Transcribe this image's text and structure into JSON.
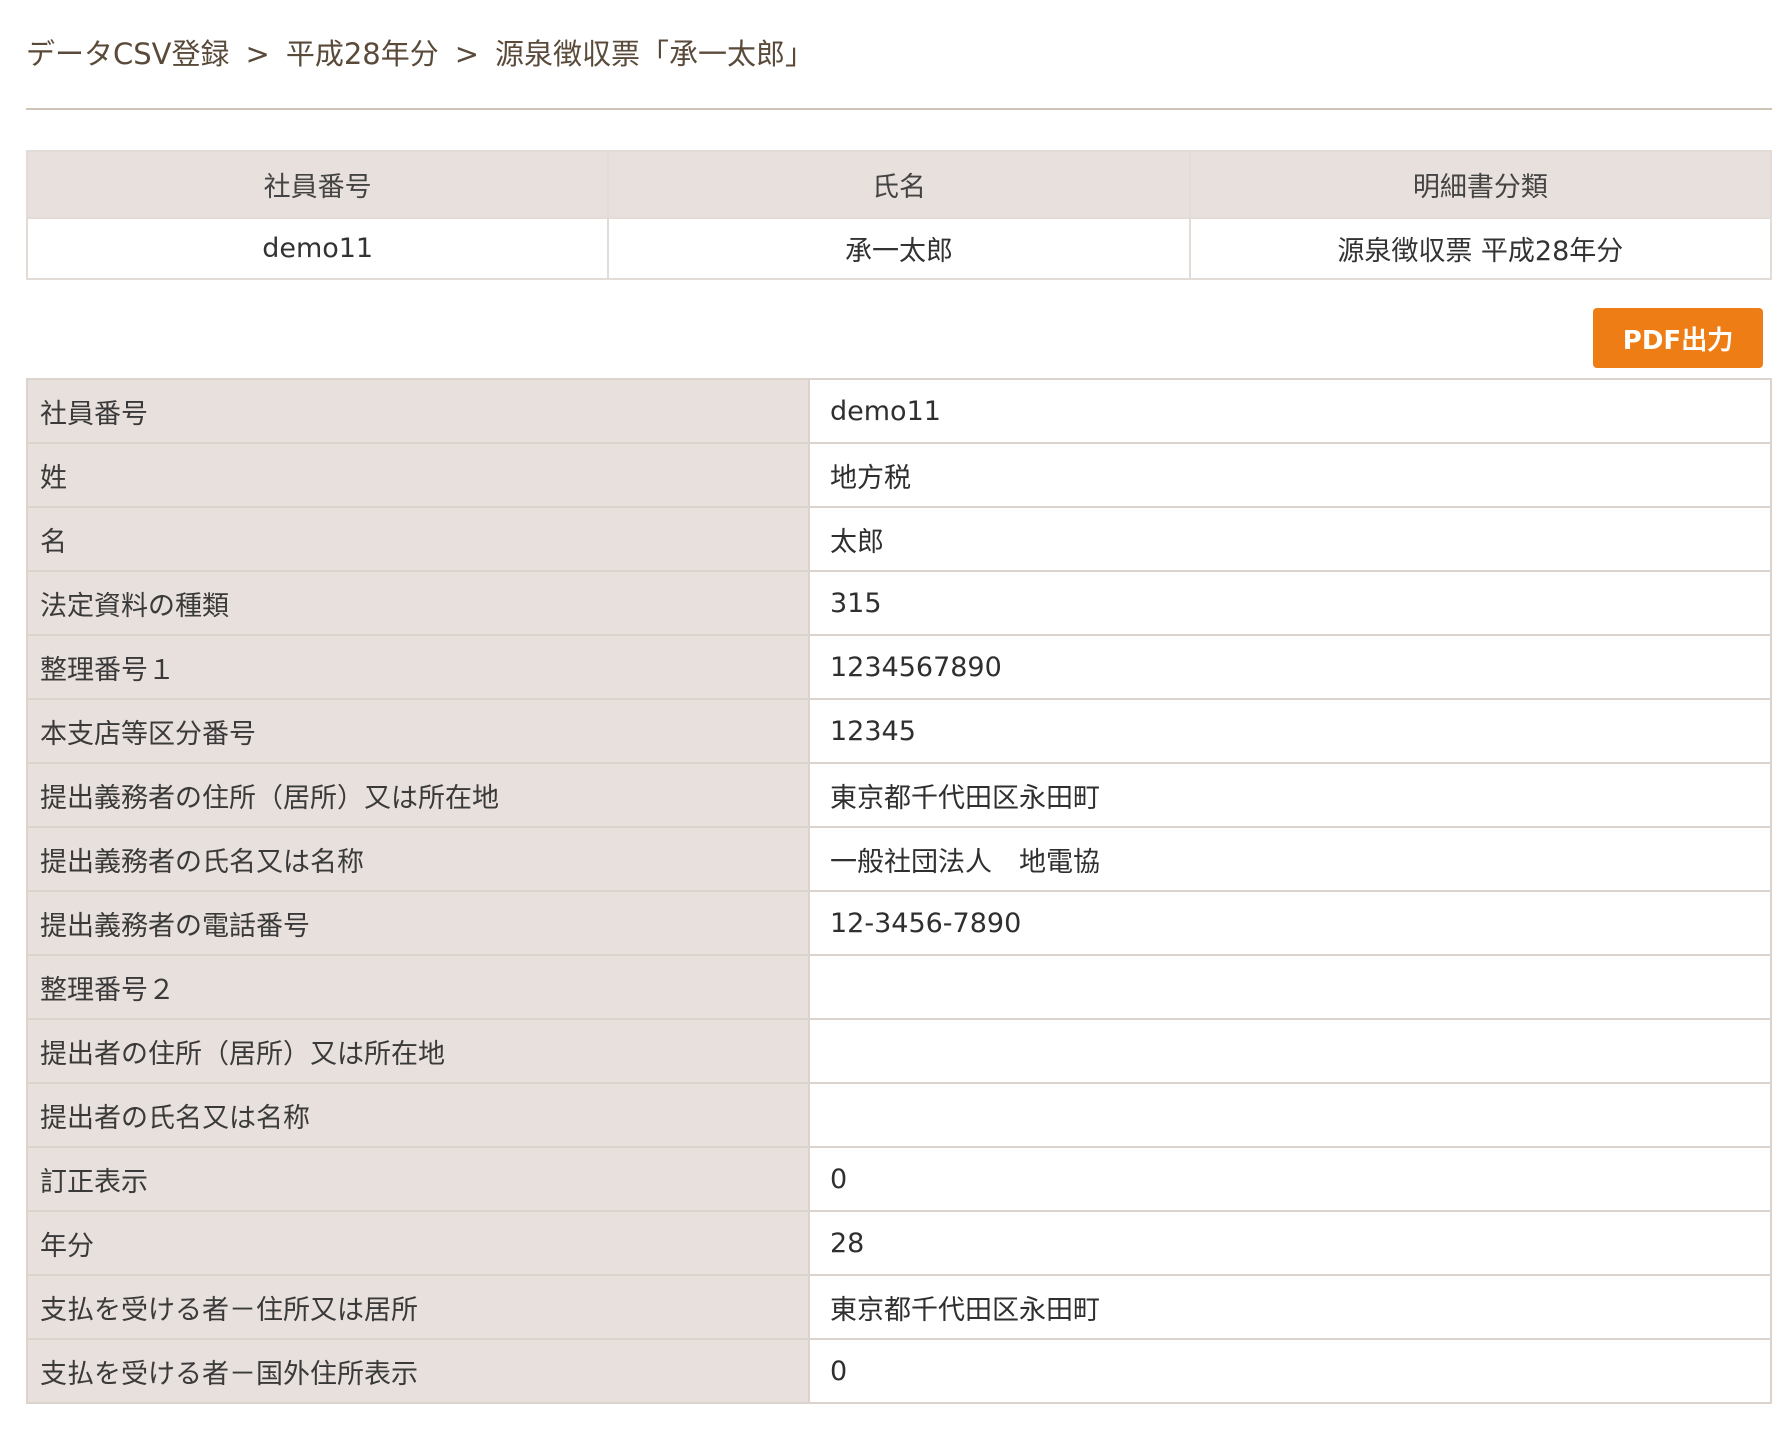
{
  "breadcrumb": {
    "level1": "データCSV登録",
    "level2": "平成28年分",
    "level3": "源泉徴収票「承一太郎」",
    "separator": ">"
  },
  "summary": {
    "headers": [
      "社員番号",
      "氏名",
      "明細書分類"
    ],
    "values": [
      "demo11",
      "承一太郎",
      "源泉徴収票 平成28年分"
    ]
  },
  "pdf_button": {
    "label": "PDF出力"
  },
  "details": [
    {
      "label": "社員番号",
      "value": "demo11"
    },
    {
      "label": "姓",
      "value": "地方税"
    },
    {
      "label": "名",
      "value": "太郎"
    },
    {
      "label": "法定資料の種類",
      "value": "315"
    },
    {
      "label": "整理番号１",
      "value": "1234567890"
    },
    {
      "label": "本支店等区分番号",
      "value": "12345"
    },
    {
      "label": "提出義務者の住所（居所）又は所在地",
      "value": "東京都千代田区永田町"
    },
    {
      "label": "提出義務者の氏名又は名称",
      "value": "一般社団法人　地電協"
    },
    {
      "label": "提出義務者の電話番号",
      "value": "12-3456-7890"
    },
    {
      "label": "整理番号２",
      "value": ""
    },
    {
      "label": "提出者の住所（居所）又は所在地",
      "value": ""
    },
    {
      "label": "提出者の氏名又は名称",
      "value": ""
    },
    {
      "label": "訂正表示",
      "value": "0"
    },
    {
      "label": "年分",
      "value": "28"
    },
    {
      "label": "支払を受ける者－住所又は居所",
      "value": "東京都千代田区永田町"
    },
    {
      "label": "支払を受ける者－国外住所表示",
      "value": "0"
    }
  ],
  "colors": {
    "header_bg": "#e8e0dc",
    "button_bg": "#ee7d16",
    "divider": "#cfc4b8"
  }
}
